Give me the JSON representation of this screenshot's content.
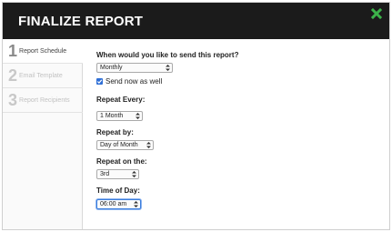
{
  "header": {
    "title": "FINALIZE REPORT"
  },
  "steps": [
    {
      "number": "1",
      "label": "Report Schedule"
    },
    {
      "number": "2",
      "label": "Email Template"
    },
    {
      "number": "3",
      "label": "Report Recipients"
    }
  ],
  "form": {
    "send_question": "When would you like to send this report?",
    "frequency_value": "Monthly",
    "send_now_label": "Send now as well",
    "send_now_checked": true,
    "repeat_every_label": "Repeat Every:",
    "repeat_every_value": "1 Month",
    "repeat_by_label": "Repeat by:",
    "repeat_by_value": "Day of Month",
    "repeat_on_label": "Repeat on the:",
    "repeat_on_value": "3rd",
    "time_label": "Time of Day:",
    "time_value": "06:00 am"
  },
  "colors": {
    "header_bg": "#1b1b1b",
    "close_icon": "#3cb34a",
    "checkbox": "#2f6fd6",
    "focus_ring": "#3b7ddd"
  }
}
